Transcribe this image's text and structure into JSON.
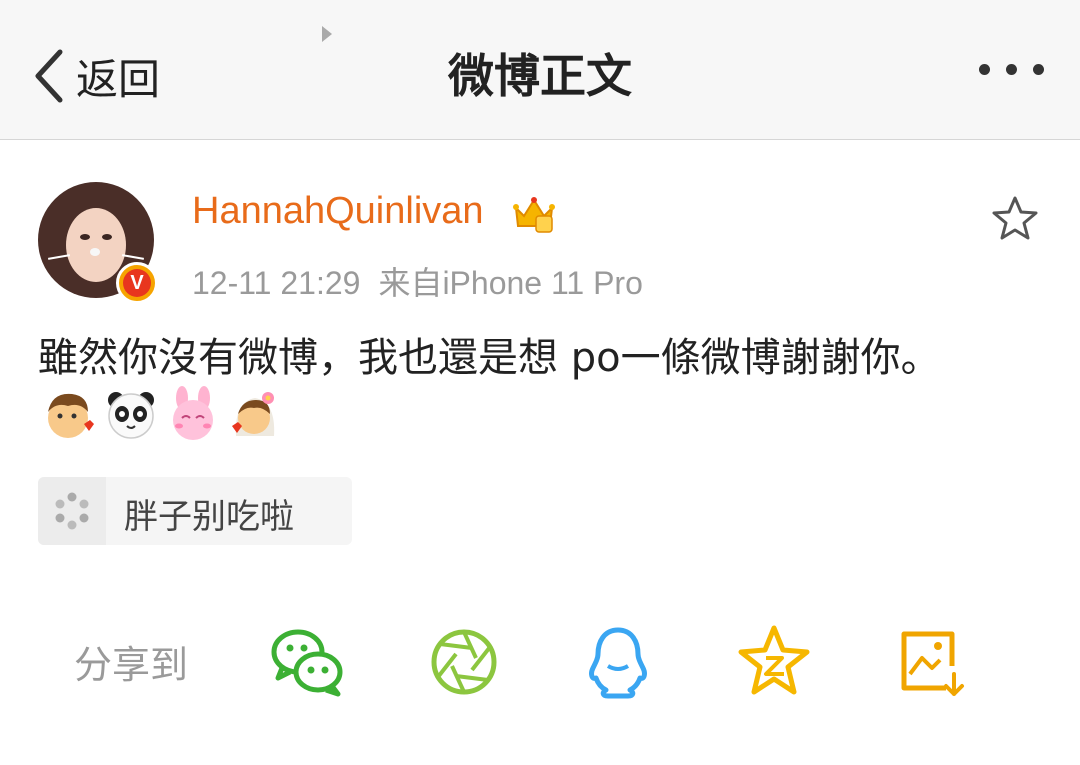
{
  "nav": {
    "back_label": "返回",
    "title": "微博正文"
  },
  "post": {
    "username": "HannahQuinlivan",
    "time": "12-11 21:29",
    "source": "来自iPhone 11 Pro",
    "verified_badge": "V",
    "content": "雖然你沒有微博，我也還是想 po一條微博謝謝你。",
    "emoticons": [
      "boy-kiss-emoticon",
      "panda-emoticon",
      "pink-bunny-emoticon",
      "bride-kiss-emoticon"
    ]
  },
  "topic": {
    "label": "胖子别吃啦"
  },
  "share": {
    "label": "分享到",
    "targets": [
      "wechat-icon",
      "moments-icon",
      "qq-icon",
      "qzone-icon",
      "save-image-icon"
    ]
  },
  "colors": {
    "username": "#e86b1a",
    "wechat": "#3cb034",
    "moments": "#8cc63f",
    "qq": "#3aa6f2",
    "qzone": "#f6b700",
    "save": "#f0a500"
  }
}
